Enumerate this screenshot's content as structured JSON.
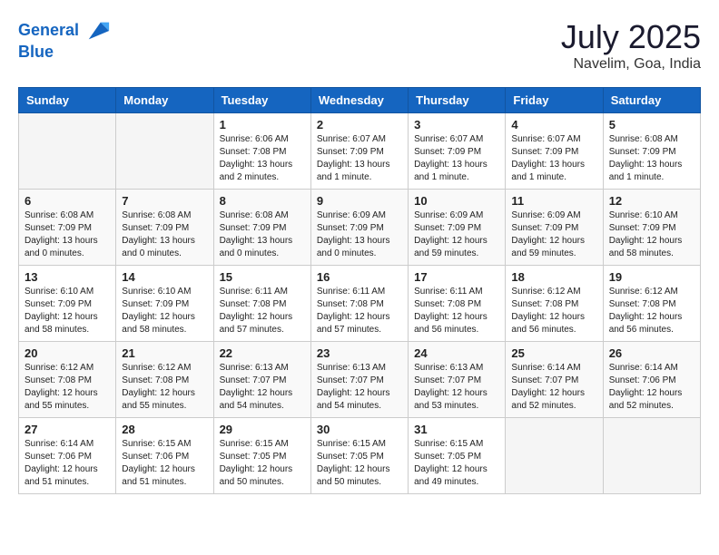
{
  "logo": {
    "line1": "General",
    "line2": "Blue"
  },
  "title": "July 2025",
  "location": "Navelim, Goa, India",
  "weekdays": [
    "Sunday",
    "Monday",
    "Tuesday",
    "Wednesday",
    "Thursday",
    "Friday",
    "Saturday"
  ],
  "weeks": [
    [
      {
        "day": "",
        "info": ""
      },
      {
        "day": "",
        "info": ""
      },
      {
        "day": "1",
        "info": "Sunrise: 6:06 AM\nSunset: 7:08 PM\nDaylight: 13 hours\nand 2 minutes."
      },
      {
        "day": "2",
        "info": "Sunrise: 6:07 AM\nSunset: 7:09 PM\nDaylight: 13 hours\nand 1 minute."
      },
      {
        "day": "3",
        "info": "Sunrise: 6:07 AM\nSunset: 7:09 PM\nDaylight: 13 hours\nand 1 minute."
      },
      {
        "day": "4",
        "info": "Sunrise: 6:07 AM\nSunset: 7:09 PM\nDaylight: 13 hours\nand 1 minute."
      },
      {
        "day": "5",
        "info": "Sunrise: 6:08 AM\nSunset: 7:09 PM\nDaylight: 13 hours\nand 1 minute."
      }
    ],
    [
      {
        "day": "6",
        "info": "Sunrise: 6:08 AM\nSunset: 7:09 PM\nDaylight: 13 hours\nand 0 minutes."
      },
      {
        "day": "7",
        "info": "Sunrise: 6:08 AM\nSunset: 7:09 PM\nDaylight: 13 hours\nand 0 minutes."
      },
      {
        "day": "8",
        "info": "Sunrise: 6:08 AM\nSunset: 7:09 PM\nDaylight: 13 hours\nand 0 minutes."
      },
      {
        "day": "9",
        "info": "Sunrise: 6:09 AM\nSunset: 7:09 PM\nDaylight: 13 hours\nand 0 minutes."
      },
      {
        "day": "10",
        "info": "Sunrise: 6:09 AM\nSunset: 7:09 PM\nDaylight: 12 hours\nand 59 minutes."
      },
      {
        "day": "11",
        "info": "Sunrise: 6:09 AM\nSunset: 7:09 PM\nDaylight: 12 hours\nand 59 minutes."
      },
      {
        "day": "12",
        "info": "Sunrise: 6:10 AM\nSunset: 7:09 PM\nDaylight: 12 hours\nand 58 minutes."
      }
    ],
    [
      {
        "day": "13",
        "info": "Sunrise: 6:10 AM\nSunset: 7:09 PM\nDaylight: 12 hours\nand 58 minutes."
      },
      {
        "day": "14",
        "info": "Sunrise: 6:10 AM\nSunset: 7:09 PM\nDaylight: 12 hours\nand 58 minutes."
      },
      {
        "day": "15",
        "info": "Sunrise: 6:11 AM\nSunset: 7:08 PM\nDaylight: 12 hours\nand 57 minutes."
      },
      {
        "day": "16",
        "info": "Sunrise: 6:11 AM\nSunset: 7:08 PM\nDaylight: 12 hours\nand 57 minutes."
      },
      {
        "day": "17",
        "info": "Sunrise: 6:11 AM\nSunset: 7:08 PM\nDaylight: 12 hours\nand 56 minutes."
      },
      {
        "day": "18",
        "info": "Sunrise: 6:12 AM\nSunset: 7:08 PM\nDaylight: 12 hours\nand 56 minutes."
      },
      {
        "day": "19",
        "info": "Sunrise: 6:12 AM\nSunset: 7:08 PM\nDaylight: 12 hours\nand 56 minutes."
      }
    ],
    [
      {
        "day": "20",
        "info": "Sunrise: 6:12 AM\nSunset: 7:08 PM\nDaylight: 12 hours\nand 55 minutes."
      },
      {
        "day": "21",
        "info": "Sunrise: 6:12 AM\nSunset: 7:08 PM\nDaylight: 12 hours\nand 55 minutes."
      },
      {
        "day": "22",
        "info": "Sunrise: 6:13 AM\nSunset: 7:07 PM\nDaylight: 12 hours\nand 54 minutes."
      },
      {
        "day": "23",
        "info": "Sunrise: 6:13 AM\nSunset: 7:07 PM\nDaylight: 12 hours\nand 54 minutes."
      },
      {
        "day": "24",
        "info": "Sunrise: 6:13 AM\nSunset: 7:07 PM\nDaylight: 12 hours\nand 53 minutes."
      },
      {
        "day": "25",
        "info": "Sunrise: 6:14 AM\nSunset: 7:07 PM\nDaylight: 12 hours\nand 52 minutes."
      },
      {
        "day": "26",
        "info": "Sunrise: 6:14 AM\nSunset: 7:06 PM\nDaylight: 12 hours\nand 52 minutes."
      }
    ],
    [
      {
        "day": "27",
        "info": "Sunrise: 6:14 AM\nSunset: 7:06 PM\nDaylight: 12 hours\nand 51 minutes."
      },
      {
        "day": "28",
        "info": "Sunrise: 6:15 AM\nSunset: 7:06 PM\nDaylight: 12 hours\nand 51 minutes."
      },
      {
        "day": "29",
        "info": "Sunrise: 6:15 AM\nSunset: 7:05 PM\nDaylight: 12 hours\nand 50 minutes."
      },
      {
        "day": "30",
        "info": "Sunrise: 6:15 AM\nSunset: 7:05 PM\nDaylight: 12 hours\nand 50 minutes."
      },
      {
        "day": "31",
        "info": "Sunrise: 6:15 AM\nSunset: 7:05 PM\nDaylight: 12 hours\nand 49 minutes."
      },
      {
        "day": "",
        "info": ""
      },
      {
        "day": "",
        "info": ""
      }
    ]
  ]
}
